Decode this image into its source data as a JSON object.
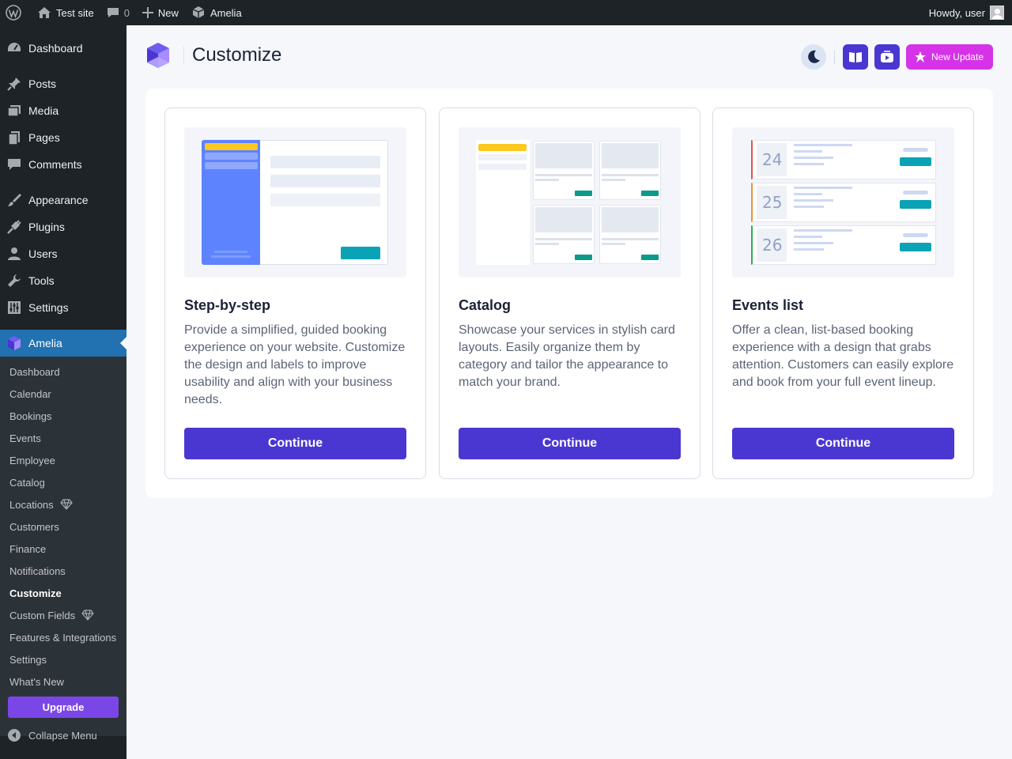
{
  "adminbar": {
    "site_name": "Test site",
    "comments_count": "0",
    "new_label": "New",
    "plugin_label": "Amelia",
    "howdy": "Howdy, user"
  },
  "sidebar": {
    "items": [
      {
        "label": "Dashboard",
        "icon": "dashboard-icon"
      },
      {
        "label": "Posts",
        "icon": "pin-icon"
      },
      {
        "label": "Media",
        "icon": "media-icon"
      },
      {
        "label": "Pages",
        "icon": "pages-icon"
      },
      {
        "label": "Comments",
        "icon": "comment-icon"
      },
      {
        "label": "Appearance",
        "icon": "brush-icon"
      },
      {
        "label": "Plugins",
        "icon": "plug-icon"
      },
      {
        "label": "Users",
        "icon": "user-icon"
      },
      {
        "label": "Tools",
        "icon": "wrench-icon"
      },
      {
        "label": "Settings",
        "icon": "sliders-icon"
      },
      {
        "label": "Amelia",
        "icon": "amelia-logo-icon"
      }
    ],
    "submenu": [
      "Dashboard",
      "Calendar",
      "Bookings",
      "Events",
      "Employee",
      "Catalog",
      "Locations",
      "Customers",
      "Finance",
      "Notifications",
      "Customize",
      "Custom Fields",
      "Features & Integrations",
      "Settings",
      "What's New"
    ],
    "upgrade_label": "Upgrade",
    "collapse_label": "Collapse Menu"
  },
  "header": {
    "title": "Customize",
    "new_update_label": "New Update"
  },
  "cards": [
    {
      "title": "Step-by-step",
      "description": "Provide a simplified, guided booking experience on your website. Customize the design and labels to improve usability and align with your business needs.",
      "button": "Continue"
    },
    {
      "title": "Catalog",
      "description": "Showcase your services in stylish card layouts. Easily organize them by category and tailor the appearance to match your brand.",
      "button": "Continue"
    },
    {
      "title": "Events list",
      "description": "Offer a clean, list-based booking experience with a design that grabs attention. Customers can easily explore and book from your full event lineup.",
      "button": "Continue"
    }
  ],
  "events_preview": {
    "days": [
      "24",
      "25",
      "26"
    ]
  },
  "colors": {
    "primary": "#4a37d1",
    "new_update": "#d633e8",
    "upgrade": "#7b46e8",
    "wp_active": "#2271b1",
    "teal": "#0aa3b5"
  }
}
